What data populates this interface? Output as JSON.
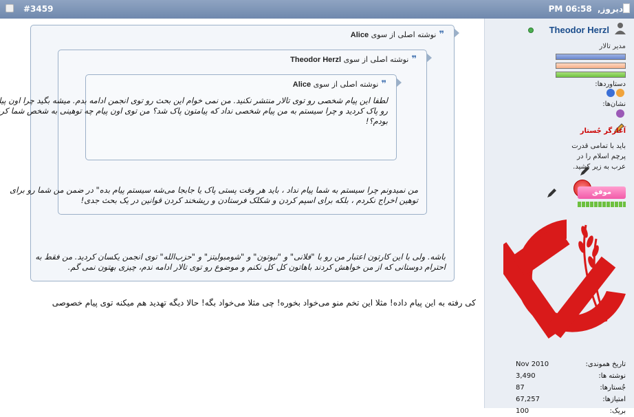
{
  "header": {
    "date": "دیروز,",
    "time": "06:58 PM",
    "post_number": "#3459"
  },
  "user": {
    "name": "Theodor Herzl",
    "title": "مدیر تالار",
    "achievements_label": "دستاوردها:",
    "medals_label": "نشان‌ها:",
    "starter_label": "آغازگر جُستار",
    "signature": "باید با تمامی قدرت پرچم اسلام را در عرب به زیر کشید.",
    "badge_label": "موفق",
    "stats": [
      {
        "label": "تاریخ هموندی:",
        "value": "Nov 2010"
      },
      {
        "label": "نوشته ها:",
        "value": "3,490"
      },
      {
        "label": "جُستارها:",
        "value": "87"
      },
      {
        "label": "امتیازها:",
        "value": "67,257"
      },
      {
        "label": "بریک:",
        "value": "100"
      }
    ]
  },
  "quotes": {
    "outer": {
      "header_prefix": "نوشته اصلی از سوی",
      "author": "Alice",
      "text": "باشه. ولی با این کارتون اعتبار من رو با \"فلانی\" و \"نیوتون\" و \"شومبولیتز\" و \"حزب‌الله\" توی انجمن یکسان کردید. من فقط به احترام دوستانی که از من خواهش کردند باهاتون کل کل نکنم و موضوع رو توی تالار ادامه ندم، چیزی بهتون نمی گم."
    },
    "middle": {
      "header_prefix": "نوشته اصلی از سوی",
      "author": "Theodor Herzl",
      "text": "من نمیدونم چرا سیستم به شما پیام نداد ، باید هر وقت پستی پاک یا جابجا می‌شه سیستم پیام بده\" در ضمن من شما رو برای توهین اخراج نکردم ، بلکه برای اسپم کردن و شکلک فرستادن و ریشخند کردن قوانین در یک بحث جدی!"
    },
    "inner": {
      "header_prefix": "نوشته اصلی از سوی",
      "author": "Alice",
      "text": "لطفا این پیام شخصی رو توی تالار منتشر نکنید. من نمی خوام این بحث رو توی انجمن ادامه بدم. میشه بگید چرا اون پیام من رو پاک کردید و چرا سیستم به من پیام شخصی نداد که پیامتون پاک شد؟ من توی اون پیام چه توهینی به شخص شما کرده بودم؟!"
    }
  },
  "reply": "کی رفته به این پیام داده! مثلا این تخم منو می‌خواد بخوره! چی مثلا می‌خواد بگه! حالا دیگه تهدید هم میکنه توی پیام خصوصی"
}
